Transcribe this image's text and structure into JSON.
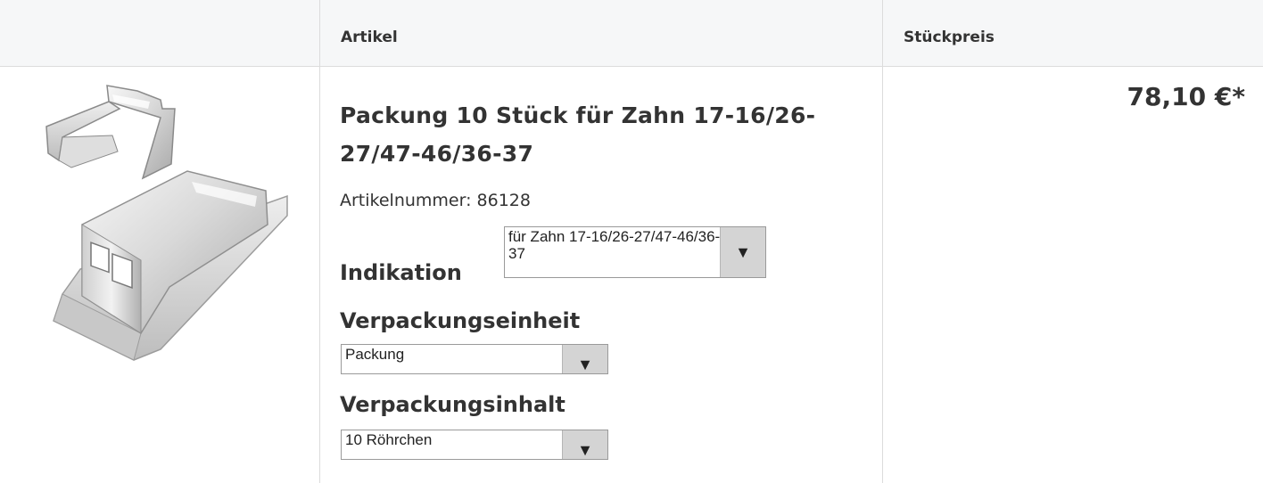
{
  "table": {
    "columns": [
      "",
      "Artikel",
      "Stückpreis"
    ]
  },
  "product": {
    "title": "Packung 10 Stück für Zahn 17-16/26-27/47-46/36-37",
    "article_number_label": "Artikelnummer:",
    "article_number": "86128",
    "price": "78,10 €*",
    "indikation": {
      "label": "Indikation",
      "selected": "für Zahn 17-16/26-27/47-46/36-37"
    },
    "verpackungseinheit": {
      "label": "Verpackungseinheit",
      "selected": "Packung"
    },
    "verpackungsinhalt": {
      "label": "Verpackungsinhalt",
      "selected": "10 Röhrchen"
    }
  },
  "icons": {
    "dropdown": "chevron-down-icon"
  }
}
